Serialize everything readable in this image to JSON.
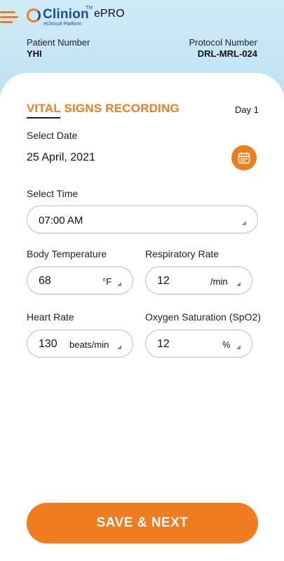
{
  "header": {
    "logo_word": "Clinion",
    "logo_tm": "TM",
    "logo_sub": "eClinical Platform",
    "app_name": "ePRO",
    "patient_label": "Patient Number",
    "patient_value": "YHI",
    "protocol_label": "Protocol Number",
    "protocol_value": "DRL-MRL-024"
  },
  "form": {
    "title": "VITAL SIGNS RECORDING",
    "day": "Day 1",
    "date_label": "Select Date",
    "date_value": "25 April, 2021",
    "time_label": "Select Time",
    "time_value": "07:00 AM",
    "body_temp_label": "Body Temperature",
    "body_temp_value": "68",
    "body_temp_unit": "°F",
    "resp_rate_label": "Respiratory Rate",
    "resp_rate_value": "12",
    "resp_rate_unit": "/min",
    "heart_rate_label": "Heart Rate",
    "heart_rate_value": "130",
    "heart_rate_unit": "beats/min",
    "spo2_label": "Oxygen Saturation (SpO2)",
    "spo2_value": "12",
    "spo2_unit": "%"
  },
  "actions": {
    "save_label": "SAVE & NEXT"
  },
  "icons": {
    "menu": "hamburger-menu-icon",
    "calendar": "calendar-icon",
    "dropdown": "dropdown-caret-icon"
  },
  "colors": {
    "accent": "#f07c22",
    "brand_blue": "#1a4f9c",
    "header_bg": "#cfeaf7"
  }
}
